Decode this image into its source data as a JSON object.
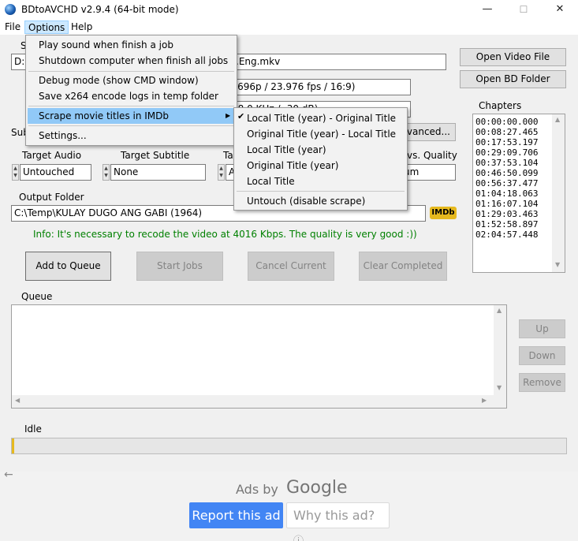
{
  "window": {
    "title": "BDtoAVCHD v2.9.4   (64-bit mode)",
    "minimize": "—",
    "maximize": "☐",
    "close": "✕"
  },
  "menubar": {
    "file": "File",
    "options": "Options",
    "help": "Help"
  },
  "options_menu": {
    "items": [
      "Play sound when finish a job",
      "Shutdown computer when finish all jobs",
      "Debug mode (show CMD window)",
      "Save x264 encode logs in temp folder",
      "Scrape movie titles in IMDb",
      "Settings..."
    ],
    "submenu_arrow": "▶"
  },
  "scrape_submenu": {
    "items": [
      "Local Title (year) - Original Title",
      "Original Title (year) - Local Title",
      "Local Title (year)",
      "Original Title (year)",
      "Local Title",
      "Untouch (disable scrape)"
    ],
    "checked_index": 0,
    "check": "✔"
  },
  "source": {
    "prefix": "S",
    "drive": "D:",
    "file_tail": ".Eng.mkv"
  },
  "video": {
    "info": "x696p / 23.976 fps / 16:9)",
    "audio_info": "48.0 KHz / -30 dB)"
  },
  "buttons": {
    "open_video": "Open Video File",
    "open_bd": "Open BD Folder",
    "advanced": "vanced...",
    "add_to_queue": "Add to Queue",
    "start_jobs": "Start Jobs",
    "cancel_current": "Cancel Current",
    "clear_completed": "Clear Completed",
    "up": "Up",
    "down": "Down",
    "remove": "Remove"
  },
  "labels": {
    "sub_prefix": "Sub",
    "target_audio": "Target Audio",
    "target_subtitle": "Target Subtitle",
    "ta_prefix": "Ta",
    "quality_suffix": "vs. Quality",
    "output_folder": "Output Folder",
    "queue": "Queue",
    "chapters": "Chapters"
  },
  "selects": {
    "target_audio": "Untouched",
    "target_subtitle": "None",
    "ta_prefix_value": "A",
    "quality_value": "um"
  },
  "output": {
    "path": "C:\\Temp\\KULAY DUGO ANG GABI (1964)",
    "imdb_badge": "IMDb"
  },
  "info": {
    "text": "Info: It's necessary to recode the video at 4016 Kbps. The quality is very good :))",
    "color": "#008000"
  },
  "chapters": [
    "00:00:00.000",
    "00:08:27.465",
    "00:17:53.197",
    "00:29:09.706",
    "00:37:53.104",
    "00:46:50.099",
    "00:56:37.477",
    "01:04:18.063",
    "01:16:07.104",
    "01:29:03.463",
    "01:52:58.897",
    "02:04:57.448"
  ],
  "status": {
    "text": "Idle",
    "progress": 0.0
  },
  "ads": {
    "back_arrow": "←",
    "ads_by": "Ads by",
    "google": "Google",
    "report": "Report this ad",
    "why": "Why this ad?",
    "why_icon": "ⓘ"
  }
}
